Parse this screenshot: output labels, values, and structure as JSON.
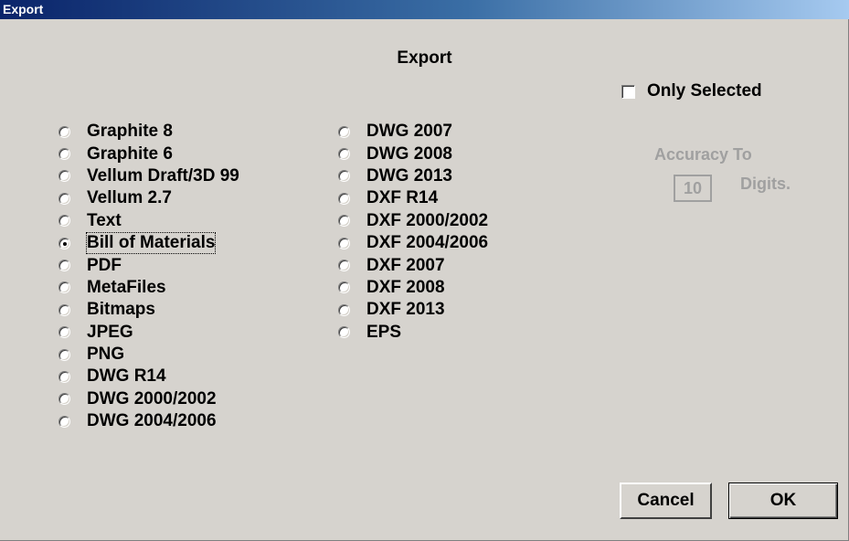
{
  "window": {
    "title": "Export"
  },
  "dialog": {
    "heading": "Export",
    "only_selected": {
      "label": "Only Selected",
      "checked": false
    },
    "accuracy": {
      "label": "Accuracy To",
      "value": "10",
      "suffix": "Digits."
    },
    "buttons": {
      "cancel": "Cancel",
      "ok": "OK"
    }
  },
  "formats_col1": [
    {
      "label": "Graphite 8",
      "selected": false
    },
    {
      "label": "Graphite 6",
      "selected": false
    },
    {
      "label": "Vellum Draft/3D 99",
      "selected": false
    },
    {
      "label": "Vellum 2.7",
      "selected": false
    },
    {
      "label": "Text",
      "selected": false
    },
    {
      "label": "Bill of Materials",
      "selected": true
    },
    {
      "label": "PDF",
      "selected": false
    },
    {
      "label": "MetaFiles",
      "selected": false
    },
    {
      "label": "Bitmaps",
      "selected": false
    },
    {
      "label": "JPEG",
      "selected": false
    },
    {
      "label": "PNG",
      "selected": false
    },
    {
      "label": "DWG R14",
      "selected": false
    },
    {
      "label": "DWG 2000/2002",
      "selected": false
    },
    {
      "label": "DWG 2004/2006",
      "selected": false
    }
  ],
  "formats_col2": [
    {
      "label": "DWG 2007",
      "selected": false
    },
    {
      "label": "DWG 2008",
      "selected": false
    },
    {
      "label": "DWG 2013",
      "selected": false
    },
    {
      "label": "DXF R14",
      "selected": false
    },
    {
      "label": "DXF 2000/2002",
      "selected": false
    },
    {
      "label": "DXF 2004/2006",
      "selected": false
    },
    {
      "label": "DXF 2007",
      "selected": false
    },
    {
      "label": "DXF 2008",
      "selected": false
    },
    {
      "label": "DXF 2013",
      "selected": false
    },
    {
      "label": "EPS",
      "selected": false
    }
  ]
}
